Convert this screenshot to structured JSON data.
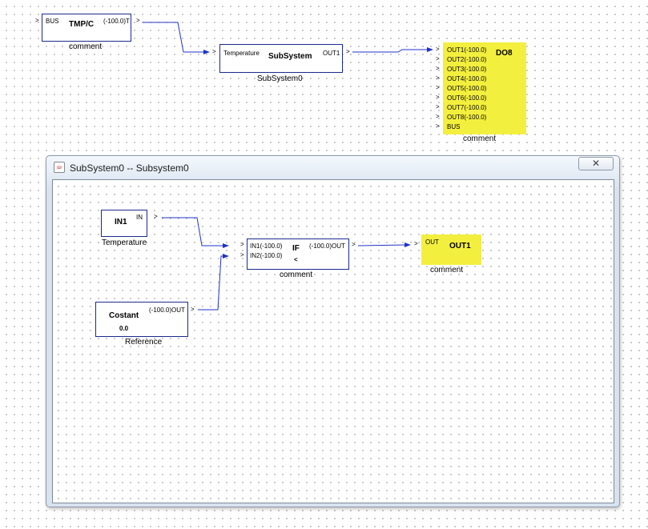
{
  "main_canvas": {
    "tmpc_block": {
      "title": "TMP/C",
      "input_port": "BUS",
      "output_port": "(-100.0)T",
      "comment": "comment"
    },
    "subsystem_block": {
      "title": "SubSystem",
      "input_port": "Temperature",
      "output_port": "OUT1",
      "comment": "SubSystem0"
    },
    "do8_block": {
      "title": "DO8",
      "ports": [
        "OUT1(-100.0)",
        "OUT2(-100.0)",
        "OUT3(-100.0)",
        "OUT4(-100.0)",
        "OUT5(-100.0)",
        "OUT6(-100.0)",
        "OUT7(-100.0)",
        "OUT8(-100.0)",
        "BUS"
      ],
      "comment": "comment"
    },
    "port_arrow": ">"
  },
  "dialog": {
    "title": "SubSystem0 -- Subsystem0",
    "close_glyph": "✕",
    "app_icon_glyph": "☕",
    "in1_block": {
      "title": "IN1",
      "output_port": "IN",
      "comment": "Temperature"
    },
    "costant_block": {
      "title": "Costant",
      "value": "0.0",
      "output_port": "(-100.0)OUT",
      "comment": "Reference"
    },
    "if_block": {
      "title": "IF",
      "operator": "<",
      "input1": "IN1(-100.0)",
      "input2": "IN2(-100.0)",
      "output_port": "(-100.0)OUT",
      "comment": "comment"
    },
    "out1_block": {
      "title": "OUT1",
      "input_port": "OUT",
      "comment": "comment"
    }
  }
}
